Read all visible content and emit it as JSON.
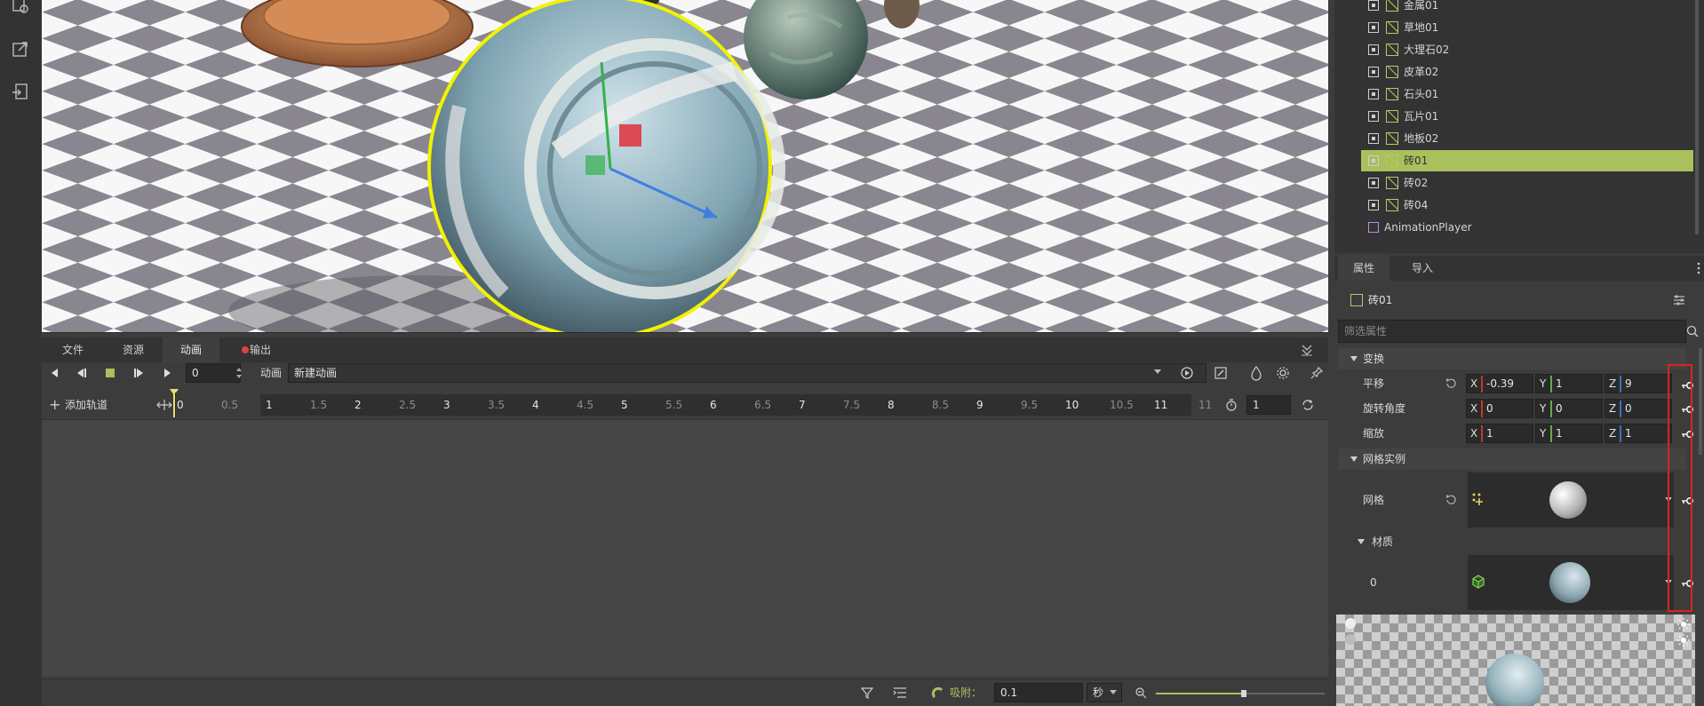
{
  "bottom_dock": {
    "tabs": [
      {
        "label": "文件"
      },
      {
        "label": "资源"
      },
      {
        "label": "动画",
        "active": true
      },
      {
        "label": "输出",
        "indicator_color": "#e04040"
      }
    ]
  },
  "animation_toolbar": {
    "frame_value": "0",
    "animation_label": "动画",
    "animation_name": "新建动画"
  },
  "timeline": {
    "add_track_label": "添加轨道",
    "ticks": [
      "0",
      "0.5",
      "1",
      "1.5",
      "2",
      "2.5",
      "3",
      "3.5",
      "4",
      "4.5",
      "5",
      "5.5",
      "6",
      "6.5",
      "7",
      "7.5",
      "8",
      "8.5",
      "9",
      "9.5",
      "10",
      "10.5",
      "11",
      "11"
    ],
    "length_value": "1"
  },
  "status_bar": {
    "snap_label": "吸附：",
    "snap_value": "0.1",
    "unit": "秒"
  },
  "scene_tree": {
    "items": [
      {
        "label": "金属01"
      },
      {
        "label": "草地01"
      },
      {
        "label": "大理石02"
      },
      {
        "label": "皮革02"
      },
      {
        "label": "石头01"
      },
      {
        "label": "瓦片01"
      },
      {
        "label": "地板02"
      },
      {
        "label": "砖01",
        "selected": true
      },
      {
        "label": "砖02"
      },
      {
        "label": "砖04"
      }
    ],
    "animation_player": "AnimationPlayer"
  },
  "inspector": {
    "tabs": [
      {
        "label": "属性",
        "active": true
      },
      {
        "label": "导入"
      }
    ],
    "node_name": "砖01",
    "filter_placeholder": "筛选属性",
    "transform_section": "变换",
    "translation": {
      "label": "平移",
      "x": "-0.39",
      "y": "1",
      "z": "9"
    },
    "rotation": {
      "label": "旋转角度",
      "x": "0",
      "y": "0",
      "z": "0"
    },
    "scale": {
      "label": "缩放",
      "x": "1",
      "y": "1",
      "z": "1"
    },
    "mesh_section": "网格实例",
    "mesh_label": "网格",
    "material_section": "材质",
    "material_index": "0",
    "axis_labels": {
      "x": "X",
      "y": "Y",
      "z": "Z"
    }
  },
  "colors": {
    "accent_selected": "#a9c05d",
    "axis_x": "#c0392b",
    "axis_y": "#6aa84f",
    "axis_z": "#3d6fc0",
    "highlight_box": "#e02020",
    "selection_outline": "#f2f200"
  }
}
